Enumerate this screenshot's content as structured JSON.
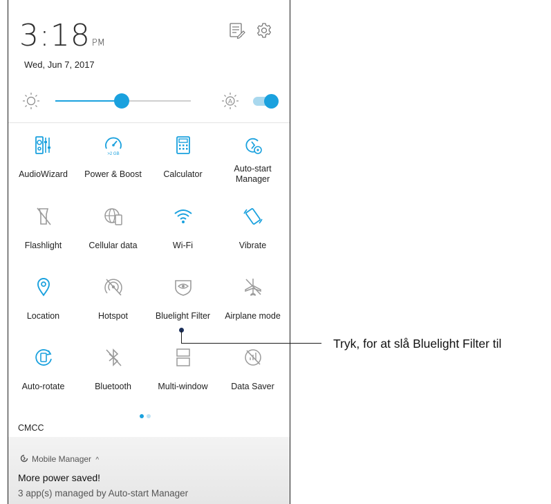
{
  "status": {
    "time": "3:18",
    "ampm": "PM",
    "date": "Wed, Jun 7, 2017"
  },
  "header_icons": [
    {
      "name": "edit-list-icon"
    },
    {
      "name": "settings-gear-icon"
    }
  ],
  "brightness": {
    "level": 0.49,
    "auto_enabled": true
  },
  "tiles": [
    {
      "label": "AudioWizard",
      "icon": "audiowizard-icon",
      "active": true
    },
    {
      "label": "Power & Boost",
      "icon": "power-boost-icon",
      "active": true,
      "badge": ">2 GB"
    },
    {
      "label": "Calculator",
      "icon": "calculator-icon",
      "active": true
    },
    {
      "label": "Auto-start\nManager",
      "icon": "autostart-manager-icon",
      "active": true
    },
    {
      "label": "Flashlight",
      "icon": "flashlight-icon",
      "active": false
    },
    {
      "label": "Cellular data",
      "icon": "cellular-data-icon",
      "active": false
    },
    {
      "label": "Wi-Fi",
      "icon": "wifi-icon",
      "active": true
    },
    {
      "label": "Vibrate",
      "icon": "vibrate-icon",
      "active": true
    },
    {
      "label": "Location",
      "icon": "location-icon",
      "active": true
    },
    {
      "label": "Hotspot",
      "icon": "hotspot-icon",
      "active": false
    },
    {
      "label": "Bluelight Filter",
      "icon": "bluelight-filter-icon",
      "active": false
    },
    {
      "label": "Airplane mode",
      "icon": "airplane-icon",
      "active": false
    },
    {
      "label": "Auto-rotate",
      "icon": "auto-rotate-icon",
      "active": true
    },
    {
      "label": "Bluetooth",
      "icon": "bluetooth-icon",
      "active": false
    },
    {
      "label": "Multi-window",
      "icon": "multi-window-icon",
      "active": false
    },
    {
      "label": "Data Saver",
      "icon": "data-saver-icon",
      "active": false
    }
  ],
  "pager": {
    "pages": 2,
    "current": 1
  },
  "carrier": "CMCC",
  "notification": {
    "app": "Mobile Manager",
    "title": "More power saved!",
    "text": "3 app(s) managed by Auto-start Manager"
  },
  "callout": {
    "text": "Tryk, for at slå Bluelight Filter til"
  },
  "colors": {
    "accent": "#1aa1de",
    "inactive": "#9a9a9a"
  }
}
